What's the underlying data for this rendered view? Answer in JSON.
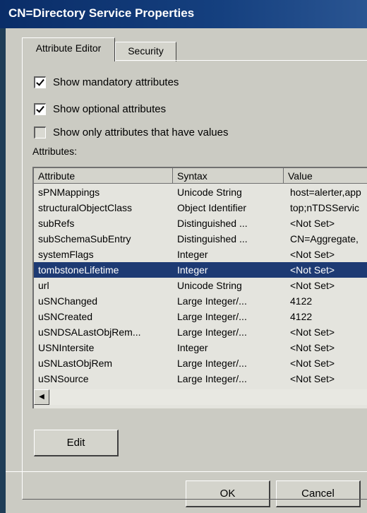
{
  "window": {
    "title": "CN=Directory Service Properties"
  },
  "tabs": [
    {
      "label": "Attribute Editor",
      "active": true
    },
    {
      "label": "Security",
      "active": false
    }
  ],
  "options": [
    {
      "label": "Show mandatory attributes",
      "checked": true
    },
    {
      "label": "Show optional attributes",
      "checked": true
    },
    {
      "label": "Show only attributes that have values",
      "checked": false
    }
  ],
  "attributes_label": "Attributes:",
  "table": {
    "columns": [
      "Attribute",
      "Syntax",
      "Value"
    ],
    "rows": [
      {
        "attribute": "sPNMappings",
        "syntax": "Unicode String",
        "value": "host=alerter,app"
      },
      {
        "attribute": "structuralObjectClass",
        "syntax": "Object Identifier",
        "value": "top;nTDSServic"
      },
      {
        "attribute": "subRefs",
        "syntax": "Distinguished ...",
        "value": "<Not Set>"
      },
      {
        "attribute": "subSchemaSubEntry",
        "syntax": "Distinguished ...",
        "value": "CN=Aggregate,"
      },
      {
        "attribute": "systemFlags",
        "syntax": "Integer",
        "value": "<Not Set>"
      },
      {
        "attribute": "tombstoneLifetime",
        "syntax": "Integer",
        "value": "<Not Set>",
        "selected": true
      },
      {
        "attribute": "url",
        "syntax": "Unicode String",
        "value": "<Not Set>"
      },
      {
        "attribute": "uSNChanged",
        "syntax": "Large Integer/...",
        "value": "4122"
      },
      {
        "attribute": "uSNCreated",
        "syntax": "Large Integer/...",
        "value": "4122"
      },
      {
        "attribute": "uSNDSALastObjRem...",
        "syntax": "Large Integer/...",
        "value": "<Not Set>"
      },
      {
        "attribute": "USNIntersite",
        "syntax": "Integer",
        "value": "<Not Set>"
      },
      {
        "attribute": "uSNLastObjRem",
        "syntax": "Large Integer/...",
        "value": "<Not Set>"
      },
      {
        "attribute": "uSNSource",
        "syntax": "Large Integer/...",
        "value": "<Not Set>"
      }
    ]
  },
  "buttons": {
    "edit": "Edit",
    "ok": "OK",
    "cancel": "Cancel"
  },
  "colors": {
    "titlebar": "#0a2d68",
    "selection": "#1d3a73",
    "dialog": "#cbcbc3"
  }
}
